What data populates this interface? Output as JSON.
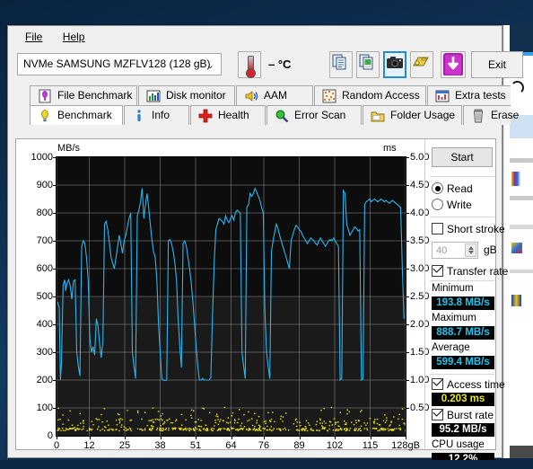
{
  "window": {
    "menu": [
      {
        "label": "File",
        "accel": "F"
      },
      {
        "label": "Help",
        "accel": "H"
      }
    ]
  },
  "toolbar": {
    "drive": {
      "interface": "NVMe",
      "model": "SAMSUNG MZFLV128 (128 gB)",
      "display": "NVMe   SAMSUNG MZFLV128 (128 gB)",
      "chevron": "⌄"
    },
    "temperature": "– °C",
    "buttons": [
      {
        "name": "copy-icon",
        "selected": false
      },
      {
        "name": "copy-image-icon",
        "selected": false
      },
      {
        "name": "screenshot-camera-icon",
        "selected": true
      },
      {
        "name": "folder-keys-icon",
        "selected": false
      },
      {
        "name": "save-download-icon",
        "selected": false
      }
    ],
    "exit_label": "Exit"
  },
  "tabs": {
    "row1": [
      {
        "label": "File Benchmark",
        "icon": "file-benchmark-icon",
        "active": false
      },
      {
        "label": "Disk monitor",
        "icon": "disk-monitor-icon",
        "active": false
      },
      {
        "label": "AAM",
        "icon": "aam-speaker-icon",
        "active": false
      },
      {
        "label": "Random Access",
        "icon": "random-access-icon",
        "active": false
      },
      {
        "label": "Extra tests",
        "icon": "extra-tests-icon",
        "active": false
      }
    ],
    "row2": [
      {
        "label": "Benchmark",
        "icon": "benchmark-bulb-icon",
        "active": true
      },
      {
        "label": "Info",
        "icon": "info-icon",
        "active": false
      },
      {
        "label": "Health",
        "icon": "health-cross-icon",
        "active": false
      },
      {
        "label": "Error Scan",
        "icon": "error-scan-magnifier-icon",
        "active": false
      },
      {
        "label": "Folder Usage",
        "icon": "folder-usage-icon",
        "active": false
      },
      {
        "label": "Erase",
        "icon": "erase-trash-icon",
        "active": false
      }
    ]
  },
  "sidebar": {
    "start_label": "Start",
    "mode": {
      "read_label": "Read",
      "write_label": "Write",
      "selected": "Read"
    },
    "short_stroke": {
      "label": "Short stroke",
      "checked": false,
      "value": "40",
      "unit": "gB"
    },
    "transfer_rate": {
      "label": "Transfer rate",
      "checked": true,
      "minimum_label": "Minimum",
      "minimum_value": "193.8 MB/s",
      "maximum_label": "Maximum",
      "maximum_value": "888.7 MB/s",
      "average_label": "Average",
      "average_value": "599.4 MB/s"
    },
    "access_time": {
      "label": "Access time",
      "checked": true,
      "value": "0.203 ms"
    },
    "burst_rate": {
      "label": "Burst rate",
      "checked": true,
      "value": "95.2 MB/s"
    },
    "cpu_usage": {
      "label": "CPU usage",
      "value": "12.2%"
    }
  },
  "colors": {
    "transfer_line": "#29b6ef",
    "access_dots": "#f2e60c",
    "plot_bg": "#0d0d0d",
    "grid": "#8a8a8a",
    "value_cyan": "#16c8f0",
    "value_yellow": "#e8e818",
    "accent_blue": "#2389da"
  },
  "chart_data": {
    "type": "line",
    "title": "",
    "xlabel": "",
    "ylabel": "MB/s",
    "y2label": "ms",
    "xunit": "gB",
    "grid": true,
    "legend": "none",
    "xlim": [
      0,
      128
    ],
    "ylim": [
      0,
      1000
    ],
    "y2lim": [
      0,
      5.0
    ],
    "xticks": [
      0,
      12,
      25,
      38,
      51,
      64,
      76,
      89,
      102,
      115,
      128
    ],
    "xtick_labels": [
      "0",
      "12",
      "25",
      "38",
      "51",
      "64",
      "76",
      "89",
      "102",
      "115",
      "128gB"
    ],
    "yticks": [
      0,
      100,
      200,
      300,
      400,
      500,
      600,
      700,
      800,
      900,
      1000
    ],
    "ytick_labels": [
      "0",
      "100",
      "200",
      "300",
      "400",
      "500",
      "600",
      "700",
      "800",
      "900",
      "1000"
    ],
    "y2ticks": [
      0.5,
      1.0,
      1.5,
      2.0,
      2.5,
      3.0,
      3.5,
      4.0,
      4.5,
      5.0
    ],
    "y2tick_labels": [
      "0.50",
      "1.00",
      "1.50",
      "2.00",
      "2.50",
      "3.00",
      "3.50",
      "4.00",
      "4.50",
      "5.00"
    ],
    "series": [
      {
        "name": "Transfer rate",
        "color": "#29b6ef",
        "axis": "left",
        "unit": "MB/s",
        "x": [
          0.4,
          1.0,
          1.4,
          1.8,
          2.4,
          3.0,
          3.4,
          3.8,
          4.4,
          5.0,
          5.6,
          6.2,
          6.8,
          7.4,
          8.0,
          8.6,
          9.2,
          9.8,
          10.4,
          11.0,
          11.6,
          12.2,
          12.8,
          13.4,
          14.0,
          14.6,
          15.2,
          15.8,
          16.4,
          17.0,
          17.6,
          18.2,
          18.8,
          19.4,
          20.0,
          20.6,
          21.2,
          21.8,
          22.4,
          23.0,
          23.6,
          24.2,
          24.8,
          25.4,
          26.0,
          26.6,
          27.2,
          27.8,
          28.4,
          29.0,
          29.6,
          30.2,
          30.8,
          31.4,
          32.0,
          32.6,
          33.2,
          33.8,
          34.4,
          35.0,
          35.6,
          36.2,
          36.8,
          37.4,
          38.0,
          38.6,
          39.2,
          39.8,
          40.4,
          41.0,
          41.6,
          42.2,
          42.8,
          43.4,
          44.0,
          44.6,
          45.2,
          45.8,
          46.4,
          47.0,
          47.6,
          48.2,
          48.8,
          49.4,
          50.0,
          50.6,
          51.2,
          51.8,
          52.4,
          53.0,
          53.6,
          54.2,
          54.8,
          55.4,
          56.0,
          56.6,
          57.2,
          57.8,
          58.4,
          59.0,
          59.6,
          60.2,
          60.8,
          61.4,
          62.0,
          62.6,
          63.2,
          63.8,
          64.4,
          65.0,
          65.6,
          66.2,
          66.8,
          67.4,
          68.0,
          68.6,
          69.2,
          69.8,
          70.4,
          71.0,
          71.6,
          72.2,
          72.8,
          73.4,
          74.0,
          74.6,
          75.2,
          75.8,
          76.4,
          77.0,
          77.6,
          78.2,
          78.8,
          79.4,
          80.0,
          80.6,
          81.2,
          81.8,
          82.4,
          83.0,
          83.6,
          84.2,
          84.8,
          85.4,
          86.0,
          86.6,
          87.2,
          87.8,
          88.4,
          89.0,
          89.6,
          90.2,
          90.8,
          91.4,
          92.0,
          92.6,
          93.2,
          93.8,
          94.4,
          95.0,
          95.6,
          96.2,
          96.8,
          97.4,
          98.0,
          98.6,
          99.2,
          99.8,
          100.4,
          101.0,
          101.6,
          102.2,
          102.8,
          103.4,
          104.0,
          104.6,
          105.2,
          105.8,
          106.4,
          107.0,
          107.6,
          108.2,
          108.8,
          109.4,
          110.0,
          110.6,
          111.2,
          111.8,
          112.4,
          113.0,
          113.6,
          114.2,
          114.8,
          115.4,
          116.0,
          116.6,
          117.2,
          117.8,
          118.4,
          119.0,
          119.6,
          120.2,
          120.8,
          121.4,
          122.0,
          122.6,
          123.2,
          123.8,
          124.4,
          125.0,
          125.6,
          126.2,
          126.8,
          127.4,
          128.0
        ],
        "y": [
          480,
          460,
          200,
          260,
          540,
          560,
          520,
          545,
          560,
          540,
          490,
          555,
          560,
          300,
          250,
          215,
          680,
          700,
          690,
          640,
          560,
          350,
          300,
          320,
          290,
          420,
          395,
          330,
          280,
          340,
          760,
          770,
          740,
          690,
          640,
          620,
          600,
          640,
          680,
          720,
          690,
          655,
          700,
          720,
          750,
          780,
          800,
          300,
          250,
          205,
          790,
          810,
          840,
          888,
          780,
          830,
          870,
          820,
          760,
          700,
          660,
          640,
          560,
          400,
          300,
          205,
          200,
          198,
          200,
          700,
          705,
          690,
          660,
          620,
          560,
          420,
          320,
          245,
          690,
          700,
          680,
          640,
          600,
          550,
          480,
          400,
          320,
          250,
          200,
          200,
          205,
          200,
          200,
          200,
          200,
          210,
          430,
          620,
          740,
          760,
          780,
          775,
          770,
          760,
          790,
          775,
          765,
          780,
          790,
          775,
          800,
          810,
          805,
          800,
          300,
          250,
          205,
          820,
          830,
          870,
          860,
          870,
          888,
          875,
          860,
          845,
          820,
          800,
          450,
          300,
          250,
          205,
          660,
          700,
          730,
          760,
          745,
          720,
          700,
          680,
          660,
          640,
          620,
          600,
          700,
          720,
          740,
          755,
          750,
          740,
          735,
          720,
          710,
          700,
          690,
          700,
          710,
          705,
          700,
          690,
          685,
          700,
          710,
          700,
          690,
          680,
          690,
          700,
          705,
          700,
          710,
          700,
          690,
          680,
          200,
          205,
          880,
          870,
          760,
          740,
          720,
          730,
          740,
          750,
          745,
          735,
          740,
          200,
          205,
          830,
          840,
          845,
          850,
          840,
          845,
          850,
          845,
          840,
          845,
          850,
          845,
          840,
          845,
          840,
          835,
          840,
          845,
          840,
          835,
          830,
          825,
          820,
          600,
          420
        ]
      },
      {
        "name": "Access time",
        "color": "#f2e60c",
        "axis": "right",
        "unit": "ms",
        "mean_ms": 0.203,
        "description": "Scatter of per-sample access times, mostly clustered between 0.05 and 0.35 ms along the bottom of the plot"
      }
    ]
  }
}
